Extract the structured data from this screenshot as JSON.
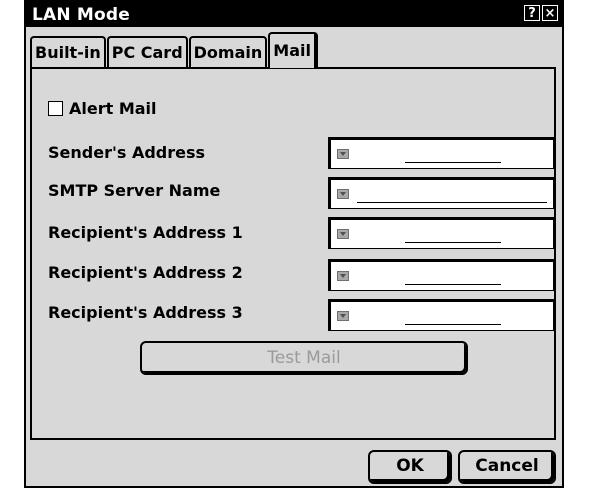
{
  "window": {
    "title": "LAN Mode",
    "help_label": "?",
    "close_label": "×"
  },
  "tabs": [
    "Built-in",
    "PC Card",
    "Domain",
    "Mail"
  ],
  "alert_mail": {
    "label": "Alert Mail",
    "checked": false
  },
  "fields": [
    {
      "label": "Sender's Address",
      "value": ""
    },
    {
      "label": "SMTP Server Name",
      "value": ""
    },
    {
      "label": "Recipient's Address 1",
      "value": ""
    },
    {
      "label": "Recipient's Address 2",
      "value": ""
    },
    {
      "label": "Recipient's Address 3",
      "value": ""
    }
  ],
  "test_mail_label": "Test Mail",
  "buttons": {
    "ok": "OK",
    "cancel": "Cancel"
  }
}
